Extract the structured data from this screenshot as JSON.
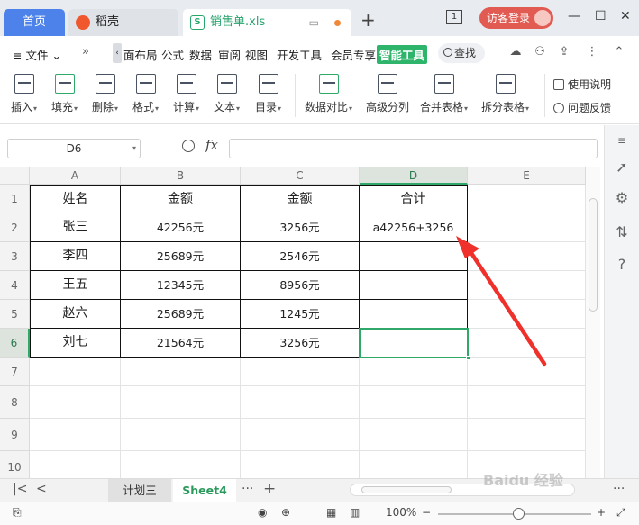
{
  "titlebar": {
    "tabs": [
      {
        "label": "首页"
      },
      {
        "label": "稻壳"
      },
      {
        "label": "销售单.xls"
      }
    ],
    "page_count": "1",
    "login_label": "访客登录",
    "accent_color": "#4c82e9",
    "login_color": "#e25b52"
  },
  "menubar": {
    "file_label": "文件",
    "items": [
      "面布局",
      "公式",
      "数据",
      "审阅",
      "视图",
      "开发工具",
      "会员专享",
      "智能工具"
    ],
    "active_item": "智能工具",
    "search_label": "查找",
    "active_color": "#2fb56b"
  },
  "ribbon": {
    "buttons": [
      {
        "label": "插入"
      },
      {
        "label": "填充"
      },
      {
        "label": "删除"
      },
      {
        "label": "格式"
      },
      {
        "label": "计算"
      },
      {
        "label": "文本"
      },
      {
        "label": "目录"
      },
      {
        "label": "数据对比"
      },
      {
        "label": "高级分列"
      },
      {
        "label": "合并表格"
      },
      {
        "label": "拆分表格"
      }
    ],
    "side": {
      "help_label": "使用说明",
      "feedback_label": "问题反馈"
    }
  },
  "formula_bar": {
    "cell_ref": "D6",
    "fx_label": "fx",
    "formula": ""
  },
  "sheet": {
    "columns": [
      "A",
      "B",
      "C",
      "D",
      "E"
    ],
    "selected_column": "D",
    "selected_row": "6",
    "rows": [
      "1",
      "2",
      "3",
      "4",
      "5",
      "6",
      "7",
      "8",
      "9",
      "10"
    ],
    "table": [
      [
        "姓名",
        "金额",
        "金额",
        "合计"
      ],
      [
        "张三",
        "42256元",
        "3256元",
        "a42256+3256"
      ],
      [
        "李四",
        "25689元",
        "2546元",
        ""
      ],
      [
        "王五",
        "12345元",
        "8956元",
        ""
      ],
      [
        "赵六",
        "25689元",
        "1245元",
        ""
      ],
      [
        "刘七",
        "21564元",
        "3256元",
        ""
      ]
    ]
  },
  "sheet_tabs": [
    {
      "label": "计划三"
    },
    {
      "label": "Sheet4"
    }
  ],
  "statusbar": {
    "zoom": "100%"
  },
  "annotation": {
    "arrow_color": "#f0312b"
  },
  "watermark": "Baidu 经验"
}
